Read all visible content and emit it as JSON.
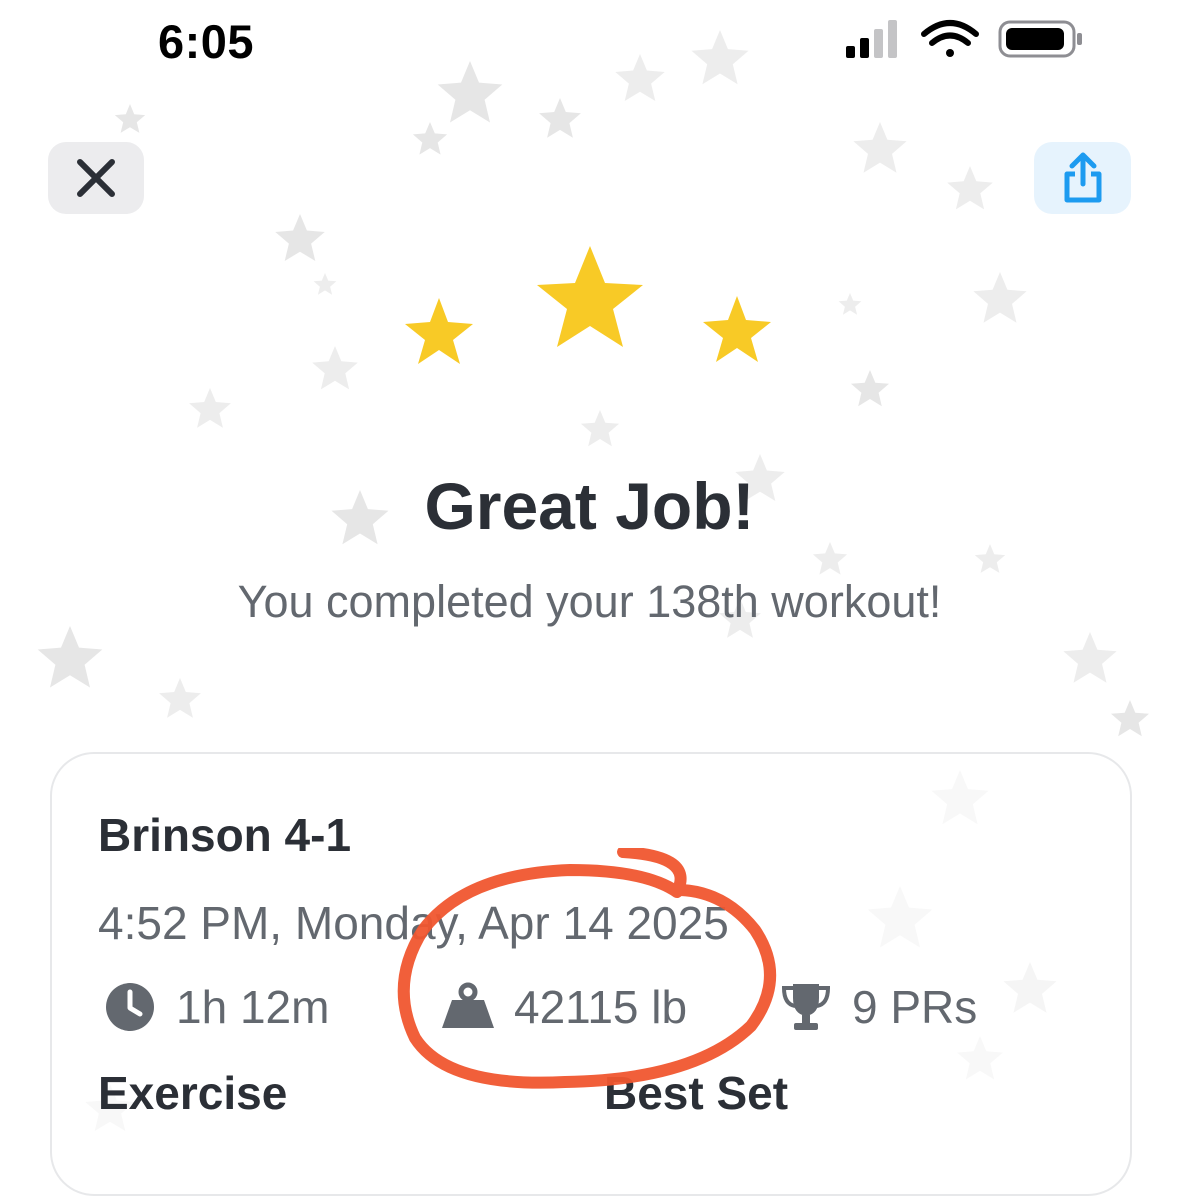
{
  "status_bar": {
    "time": "6:05",
    "icons": [
      "cellular-signal-icon",
      "wifi-icon",
      "battery-icon"
    ]
  },
  "header": {
    "close_icon": "close-icon",
    "share_icon": "share-icon"
  },
  "rating": {
    "stars_filled": 3,
    "stars_total": 3,
    "star_color": "#f8ca26"
  },
  "title": "Great Job!",
  "subtitle": "You completed your 138th workout!",
  "workout": {
    "name": "Brinson 4-1",
    "datetime": "4:52 PM, Monday, Apr 14 2025",
    "stats": {
      "duration": {
        "icon": "clock-icon",
        "value": "1h 12m"
      },
      "volume": {
        "icon": "weight-icon",
        "value": "42115 lb"
      },
      "prs": {
        "icon": "trophy-icon",
        "value": "9 PRs"
      }
    },
    "columns": {
      "exercise": "Exercise",
      "best_set": "Best Set"
    }
  },
  "colors": {
    "accent_blue": "#1d9bf0",
    "annotation_red": "#f0562f",
    "text_dark": "#2b2f36",
    "text_gray": "#63686f"
  }
}
